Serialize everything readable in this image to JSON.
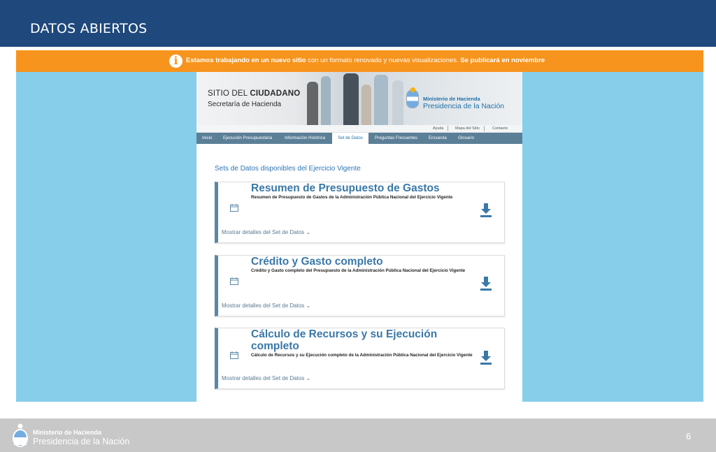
{
  "slide": {
    "title": "DATOS ABIERTOS",
    "page_number": "6"
  },
  "notice": {
    "bold_1": "Estamos trabajando en un nuevo sitio",
    "text": " con un formato renovado y nuevas visualizaciones. ",
    "bold_2": "Se publicará en noviembre"
  },
  "site": {
    "brand_line1_a": "SITIO DEL ",
    "brand_line1_b": "CIUDADANO",
    "brand_line2": "Secretaría de Hacienda",
    "ministry_line1": "Ministerio de Hacienda",
    "ministry_line2": "Presidencia de la Nación",
    "utility_links": [
      "Ayuda",
      "Mapa del Sitio",
      "Contacto"
    ],
    "nav_tabs": [
      "Inicio",
      "Ejecución Presupuestaria",
      "Información Histórica",
      "Set de Datos",
      "Preguntas Frecuentes",
      "Encuesta",
      "Glosario"
    ],
    "active_tab": "Set de Datos",
    "section_title": "Sets de Datos disponibles del Ejercicio Vigente",
    "datasets": [
      {
        "title": "Resumen de Presupuesto de Gastos",
        "description": "Resumen de Presupuesto de Gastos de la Administración Pública Nacional del Ejercicio Vigente",
        "details_link": "Mostrar detalles del Set de Datos ⌄"
      },
      {
        "title": "Crédito y Gasto completo",
        "description": "Crédito y Gasto completo del Presupuesto de la Administración Pública Nacional del Ejercicio Vigente",
        "details_link": "Mostrar detalles del Set de Datos ⌄"
      },
      {
        "title": "Cálculo de Recursos y su Ejecución completo",
        "description": "Cálculo de Recursos y su Ejecución completo de la Administración Pública Nacional del Ejercicio Vigente",
        "details_link": "Mostrar detalles del Set de Datos ⌄"
      }
    ]
  },
  "footer": {
    "line1": "Ministerio de Hacienda",
    "line2": "Presidencia de la Nación"
  },
  "colors": {
    "header_blue": "#1f497d",
    "notice_orange": "#f7941d",
    "screen_bg": "#87ceeb",
    "nav_bar": "#5b7f97",
    "link_blue": "#3a78a8",
    "footer_gray": "#c8c8c8"
  },
  "icons": {
    "notice": "info-icon",
    "dataset_date": "calendar-icon",
    "dataset_action": "download-icon"
  }
}
